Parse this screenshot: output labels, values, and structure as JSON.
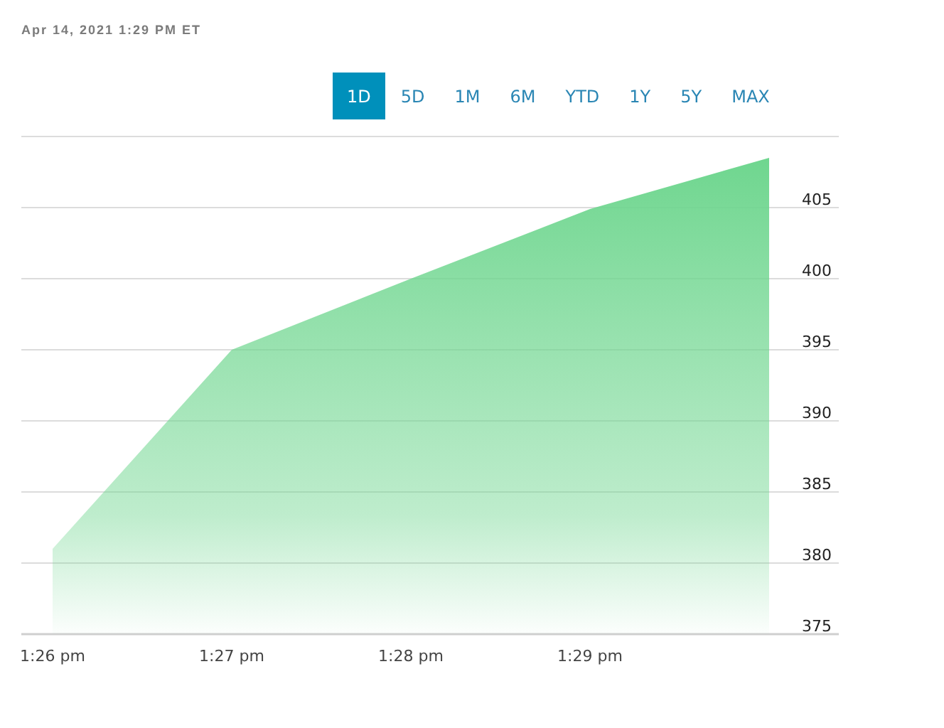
{
  "timestamp": "Apr 14, 2021 1:29 PM ET",
  "ranges": [
    {
      "label": "1D",
      "selected": true
    },
    {
      "label": "5D",
      "selected": false
    },
    {
      "label": "1M",
      "selected": false
    },
    {
      "label": "6M",
      "selected": false
    },
    {
      "label": "YTD",
      "selected": false
    },
    {
      "label": "1Y",
      "selected": false
    },
    {
      "label": "5Y",
      "selected": false
    },
    {
      "label": "MAX",
      "selected": false
    }
  ],
  "chart": {
    "chart_data": {
      "type": "area",
      "categories": [
        "1:26 pm",
        "1:27 pm",
        "1:28 pm",
        "1:29 pm",
        null
      ],
      "series": [
        {
          "color": "#6fd68f",
          "values": [
            381,
            395,
            400,
            404.9,
            408.5
          ]
        }
      ],
      "ylim": [
        375,
        410
      ],
      "grid": true,
      "yticks": [
        375,
        380,
        385,
        390,
        395,
        400,
        405
      ]
    }
  }
}
